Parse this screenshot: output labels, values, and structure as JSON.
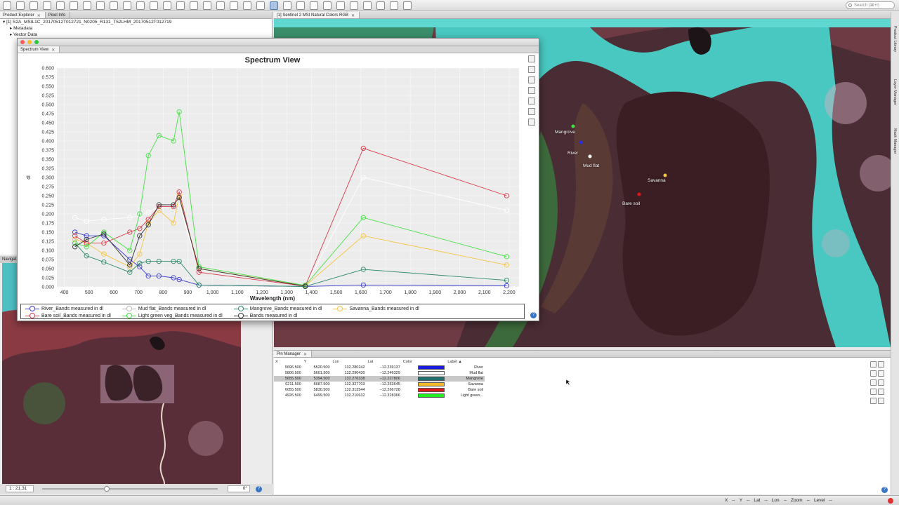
{
  "toolbar": {
    "icon_names": [
      "open-product-icon",
      "save-icon",
      "undo-icon",
      "redo-icon",
      "export-icon",
      "layer-icon",
      "chart-icon",
      "globe-icon",
      "band-maths-icon",
      "filter-icon",
      "histogram-icon",
      "scatter-icon",
      "profile-icon",
      "spectrum-icon",
      "statistics-icon",
      "info-icon",
      "pin-icon",
      "gcp-icon",
      "select-icon",
      "pan-icon",
      "zoom-icon",
      "range-finder-icon",
      "draw-line-icon",
      "polygon-icon",
      "rectangle-icon",
      "ellipse-icon",
      "magic-wand-icon",
      "world-view-icon",
      "sync-cursor-icon",
      "sync-view-icon",
      "tile-icon"
    ],
    "search_placeholder": "Search (⌘+I)"
  },
  "left_panel": {
    "tabs": [
      {
        "label": "Product Explorer"
      },
      {
        "label": "Pixel Info"
      }
    ],
    "tree": [
      {
        "label": "[1] S2A_MSIL1C_20170512T012721_N0205_R131_T52LHM_20170512T012719"
      },
      {
        "label": "Metadata"
      },
      {
        "label": "Vector Data"
      }
    ]
  },
  "image_view": {
    "tab_label": "[1] Sentinel 2 MSI Natural Colors RGB",
    "pins": [
      {
        "label": "Mangrove"
      },
      {
        "label": "River"
      },
      {
        "label": "Mud flat"
      },
      {
        "label": "Savanna"
      },
      {
        "label": "Bare soil"
      }
    ]
  },
  "right_sidebar": {
    "items": [
      "Product Library",
      "Layer Manager",
      "Mask Manager"
    ]
  },
  "navigation": {
    "tab_label": "Navigat",
    "scale": "1 : 21.31",
    "rotation": "0°",
    "help": "?"
  },
  "spectrum_window": {
    "tab_label": "Spectrum View",
    "help": "?",
    "side_tool_names": [
      "filter-icon",
      "grid-icon",
      "legend-icon",
      "zoom-icon",
      "table-icon",
      "export-icon",
      "spectrum-icon"
    ],
    "legend": [
      {
        "label": "River_Bands measured in dl",
        "color": "#3a3ad0"
      },
      {
        "label": "Mud flat_Bands measured in dl",
        "color": "#ffffff"
      },
      {
        "label": "Mangrove_Bands measured in dl",
        "color": "#2f8a6a"
      },
      {
        "label": "Savanna_Bands measured in dl",
        "color": "#f4c542"
      },
      {
        "label": "Bare soil_Bands measured in dl",
        "color": "#d83a4a"
      },
      {
        "label": "Light green veg_Bands measured in dl",
        "color": "#44e044"
      },
      {
        "label": "Bands measured in dl",
        "color": "#333333"
      }
    ]
  },
  "chart_data": {
    "type": "line",
    "title": "Spectrum View",
    "xlabel": "Wavelength (nm)",
    "ylabel": "dl",
    "xlim": [
      370,
      2240
    ],
    "ylim": [
      0,
      0.6
    ],
    "x_ticks": [
      400,
      500,
      600,
      700,
      800,
      900,
      1000,
      1100,
      1200,
      1300,
      1400,
      1500,
      1600,
      1700,
      1800,
      1900,
      2000,
      2100,
      2200
    ],
    "y_ticks": [
      0,
      0.025,
      0.05,
      0.075,
      0.1,
      0.125,
      0.15,
      0.175,
      0.2,
      0.225,
      0.25,
      0.275,
      0.3,
      0.325,
      0.35,
      0.375,
      0.4,
      0.425,
      0.45,
      0.475,
      0.5,
      0.525,
      0.55,
      0.575,
      0.6
    ],
    "x_tick_labels": [
      "400",
      "500",
      "600",
      "700",
      "800",
      "900",
      "1,000",
      "1,100",
      "1,200",
      "1,300",
      "1,400",
      "1,500",
      "1,600",
      "1,700",
      "1,800",
      "1,900",
      "2,000",
      "2,100",
      "2,200"
    ],
    "y_tick_labels": [
      "0.000",
      "0.025",
      "0.050",
      "0.075",
      "0.100",
      "0.125",
      "0.150",
      "0.175",
      "0.200",
      "0.225",
      "0.250",
      "0.275",
      "0.300",
      "0.325",
      "0.350",
      "0.375",
      "0.400",
      "0.425",
      "0.450",
      "0.475",
      "0.500",
      "0.525",
      "0.550",
      "0.575",
      "0.600"
    ],
    "grid": true,
    "legend_position": "bottom",
    "x": [
      443,
      490,
      560,
      665,
      705,
      740,
      783,
      842,
      865,
      945,
      1375,
      1610,
      2190
    ],
    "series": [
      {
        "name": "River_Bands measured in dl",
        "color": "#3a3ad0",
        "values": [
          0.15,
          0.14,
          0.14,
          0.075,
          0.055,
          0.03,
          0.03,
          0.025,
          0.02,
          0.005,
          0.001,
          0.005,
          0.003
        ]
      },
      {
        "name": "Mud flat_Bands measured in dl",
        "color": "#ffffff",
        "values": [
          0.19,
          0.18,
          0.185,
          0.19,
          0.195,
          0.205,
          0.22,
          0.225,
          0.23,
          0.04,
          0.002,
          0.3,
          0.21
        ]
      },
      {
        "name": "Mangrove_Bands measured in dl",
        "color": "#2f8a6a",
        "values": [
          0.12,
          0.085,
          0.068,
          0.04,
          0.065,
          0.07,
          0.07,
          0.07,
          0.07,
          0.005,
          0.001,
          0.048,
          0.018
        ]
      },
      {
        "name": "Savanna_Bands measured in dl",
        "color": "#f4c542",
        "values": [
          0.13,
          0.12,
          0.09,
          0.055,
          0.09,
          0.175,
          0.21,
          0.175,
          0.25,
          0.05,
          0.003,
          0.14,
          0.06
        ]
      },
      {
        "name": "Bare soil_Bands measured in dl",
        "color": "#d83a4a",
        "values": [
          0.14,
          0.12,
          0.12,
          0.15,
          0.16,
          0.185,
          0.22,
          0.22,
          0.26,
          0.04,
          0.002,
          0.38,
          0.25
        ]
      },
      {
        "name": "Light green veg_Bands measured in dl",
        "color": "#44e044",
        "values": [
          0.12,
          0.11,
          0.15,
          0.1,
          0.2,
          0.36,
          0.415,
          0.4,
          0.48,
          0.055,
          0.004,
          0.19,
          0.083
        ]
      },
      {
        "name": "Bands measured in dl",
        "color": "#333333",
        "values": [
          0.11,
          0.13,
          0.145,
          0.06,
          0.14,
          0.17,
          0.225,
          0.225,
          0.245,
          0.05,
          0.002,
          null,
          null
        ]
      }
    ]
  },
  "pin_manager": {
    "tab_label": "Pin Manager",
    "columns": [
      "X",
      "Y",
      "Lon",
      "Lat",
      "Color",
      "Label"
    ],
    "sort_indicator": "▲",
    "rows": [
      {
        "x": "5696.500",
        "y": "5520.500",
        "lon": "132.280242",
        "lat": "−12.239137",
        "color": "#1a1ae0",
        "label": "River"
      },
      {
        "x": "5806.500",
        "y": "5601.500",
        "lon": "132.290430",
        "lat": "−12.246329",
        "color": "#ffffff",
        "label": "Mud flat"
      },
      {
        "x": "5655.500",
        "y": "5394.500",
        "lon": "132.276338",
        "lat": "−12.227806",
        "color": "#1e6e6e",
        "label": "Mangrove"
      },
      {
        "x": "6211.500",
        "y": "5687.500",
        "lon": "132.327703",
        "lat": "−12.253645",
        "color": "#f2b82a",
        "label": "Savanna"
      },
      {
        "x": "6055.500",
        "y": "5830.500",
        "lon": "132.313544",
        "lat": "−12.266728",
        "color": "#e01818",
        "label": "Bare soil"
      },
      {
        "x": "4926.500",
        "y": "6499.500",
        "lon": "132.210632",
        "lat": "−12.328366",
        "color": "#22ee22",
        "label": "Light green..."
      }
    ],
    "selected_row": 2,
    "tool_names": [
      "new-pin-icon",
      "copy-pin-icon",
      "edit-pin-icon",
      "delete-pin-icon",
      "place-pin-icon",
      "table-icon",
      "filter-icon",
      "export-icon",
      "zoom-to-pin-icon",
      "import-icon"
    ],
    "help": "?"
  },
  "statusbar": {
    "x": "X",
    "x_val": "--",
    "y": "Y",
    "y_val": "--",
    "lat": "Lat",
    "lat_val": "--",
    "lon": "Lon",
    "lon_val": "--",
    "zoom": "Zoom",
    "zoom_val": "--",
    "level": "Level",
    "level_val": "--"
  }
}
